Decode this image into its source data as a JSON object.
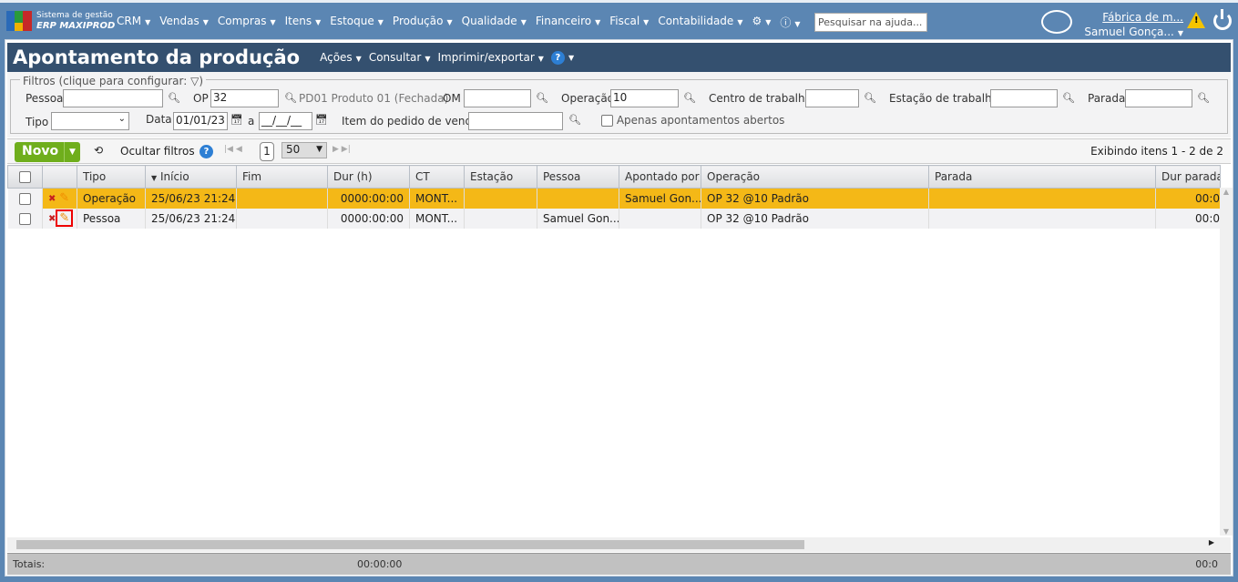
{
  "app": {
    "logo_line1": "Sistema de gestão",
    "logo_line2": "ERP MAXIPROD",
    "company": "Fábrica de m...",
    "user": "Samuel Gonça...",
    "help_placeholder": "Pesquisar na ajuda..."
  },
  "menu": [
    "CRM",
    "Vendas",
    "Compras",
    "Itens",
    "Estoque",
    "Produção",
    "Qualidade",
    "Financeiro",
    "Fiscal",
    "Contabilidade"
  ],
  "page": {
    "title": "Apontamento da produção",
    "menu": [
      "Ações",
      "Consultar",
      "Imprimir/exportar"
    ]
  },
  "filters": {
    "legend": "Filtros (clique para configurar:",
    "legend_end": ")",
    "pessoa_label": "Pessoa",
    "pessoa": "",
    "op_label": "OP",
    "op": "32",
    "op_desc": "PD01 Produto 01 (Fechada)",
    "om_label": "OM",
    "om": "",
    "operacao_label": "Operação",
    "operacao": "10",
    "ct_label": "Centro de trabalho",
    "ct": "",
    "estacao_label": "Estação de trabalho",
    "estacao": "",
    "parada_label": "Parada",
    "parada": "",
    "tipo_label": "Tipo",
    "tipo": "",
    "data_label": "Data",
    "data_from": "01/01/23",
    "a_label": "a",
    "data_to": "__/__/__",
    "item_label": "Item do pedido de venda",
    "item": "",
    "abertos_label": "Apenas apontamentos abertos"
  },
  "toolbar": {
    "novo": "Novo",
    "ocultar": "Ocultar filtros",
    "page": "1",
    "page_size": "50",
    "showing": "Exibindo itens 1 - 2 de 2"
  },
  "columns": [
    "Tipo",
    "Início",
    "Fim",
    "Dur (h)",
    "CT",
    "Estação",
    "Pessoa",
    "Apontado por",
    "Operação",
    "Parada",
    "Dur parada"
  ],
  "rows": [
    {
      "tipo": "Operação",
      "inicio": "25/06/23 21:24",
      "fim": "",
      "dur": "0000:00:00",
      "ct": "MONT...",
      "estacao": "",
      "pessoa": "",
      "apontado": "Samuel Gon...",
      "operacao": "OP 32 @10 Padrão",
      "parada": "",
      "dur_parada": "00:0"
    },
    {
      "tipo": "Pessoa",
      "inicio": "25/06/23 21:24",
      "fim": "",
      "dur": "0000:00:00",
      "ct": "MONT...",
      "estacao": "",
      "pessoa": "Samuel Gon...",
      "apontado": "",
      "operacao": "OP 32 @10 Padrão",
      "parada": "",
      "dur_parada": "00:0"
    }
  ],
  "totals": {
    "label": "Totais:",
    "dur": "00:00:00",
    "dur_parada": "00:0"
  },
  "colors": {
    "header": "#5b86b3",
    "titlebar": "#34506f",
    "selected_row": "#f4b817",
    "novo": "#6fae1c"
  }
}
